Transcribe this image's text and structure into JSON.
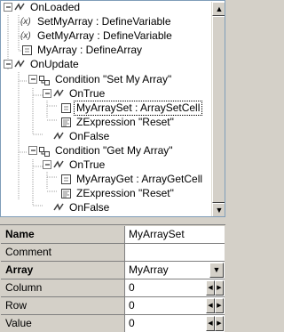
{
  "tree": {
    "nodes": [
      {
        "name": "tree-node-onloaded",
        "label": "OnLoaded",
        "icon": "event-icon"
      },
      {
        "name": "tree-node-setmyarray-definevariable",
        "label": "SetMyArray : DefineVariable",
        "icon": "variable-icon"
      },
      {
        "name": "tree-node-getmyarray-definevariable",
        "label": "GetMyArray : DefineVariable",
        "icon": "variable-icon"
      },
      {
        "name": "tree-node-myarray-definearray",
        "label": "MyArray : DefineArray",
        "icon": "component-icon"
      },
      {
        "name": "tree-node-onupdate",
        "label": "OnUpdate",
        "icon": "event-icon"
      },
      {
        "name": "tree-node-condition-set-my-array",
        "label": "Condition \"Set My Array\"",
        "icon": "condition-icon"
      },
      {
        "name": "tree-node-ontrue-1",
        "label": "OnTrue",
        "icon": "event-icon"
      },
      {
        "name": "tree-node-myarrayset-arraysetcell",
        "label": "MyArraySet : ArraySetCell",
        "icon": "component-icon"
      },
      {
        "name": "tree-node-zexpression-reset-1",
        "label": "ZExpression \"Reset\"",
        "icon": "expression-icon"
      },
      {
        "name": "tree-node-onfalse-1",
        "label": "OnFalse",
        "icon": "event-icon"
      },
      {
        "name": "tree-node-condition-get-my-array",
        "label": "Condition \"Get My Array\"",
        "icon": "condition-icon"
      },
      {
        "name": "tree-node-ontrue-2",
        "label": "OnTrue",
        "icon": "event-icon"
      },
      {
        "name": "tree-node-myarrayget-arraygetcell",
        "label": "MyArrayGet : ArrayGetCell",
        "icon": "component-icon"
      },
      {
        "name": "tree-node-zexpression-reset-2",
        "label": "ZExpression \"Reset\"",
        "icon": "expression-icon"
      },
      {
        "name": "tree-node-onfalse-2",
        "label": "OnFalse",
        "icon": "event-icon"
      }
    ],
    "selected": "MyArraySet : ArraySetCell"
  },
  "properties": {
    "name_label": "Name",
    "name_value": "MyArraySet",
    "comment_label": "Comment",
    "comment_value": "",
    "array_label": "Array",
    "array_value": "MyArray",
    "column_label": "Column",
    "column_value": "0",
    "row_label": "Row",
    "row_value": "0",
    "value_label": "Value",
    "value_value": "0"
  },
  "colors": {
    "tree_border": "#7f9db9",
    "panel_bg": "#d4d0c8"
  }
}
